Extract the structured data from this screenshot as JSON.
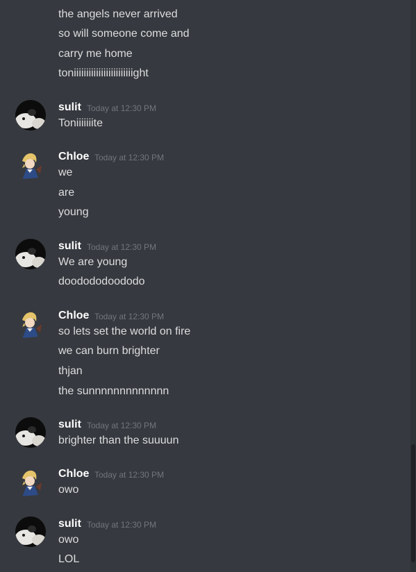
{
  "messages": {
    "g0": {
      "lines": [
        "the angels never arrived",
        "so will someone come and",
        "carry me home",
        "toniiiiiiiiiiiiiiiiiiiiiiiight"
      ]
    },
    "g1": {
      "author": "sulit",
      "time": "Today at 12:30 PM",
      "avatar": "cat-avatar",
      "lines": [
        "Toniiiiiiite"
      ]
    },
    "g2": {
      "author": "Chloe",
      "time": "Today at 12:30 PM",
      "avatar": "anime-character-avatar",
      "lines": [
        "we",
        "are",
        "young"
      ]
    },
    "g3": {
      "author": "sulit",
      "time": "Today at 12:30 PM",
      "avatar": "cat-avatar",
      "lines": [
        "We are young",
        "doodododoododo"
      ]
    },
    "g4": {
      "author": "Chloe",
      "time": "Today at 12:30 PM",
      "avatar": "anime-character-avatar",
      "lines": [
        "so lets set the world on fire",
        "we can burn brighter",
        "thjan",
        "the sunnnnnnnnnnnnn"
      ]
    },
    "g5": {
      "author": "sulit",
      "time": "Today at 12:30 PM",
      "avatar": "cat-avatar",
      "lines": [
        "brighter than the suuuun"
      ]
    },
    "g6": {
      "author": "Chloe",
      "time": "Today at 12:30 PM",
      "avatar": "anime-character-avatar",
      "lines": [
        "owo"
      ]
    },
    "g7": {
      "author": "sulit",
      "time": "Today at 12:30 PM",
      "avatar": "cat-avatar",
      "lines": [
        "owo",
        "LOL"
      ]
    }
  },
  "colors": {
    "background": "#36393f",
    "message_text": "#dcddde",
    "username": "#ffffff",
    "timestamp": "#72767d"
  }
}
